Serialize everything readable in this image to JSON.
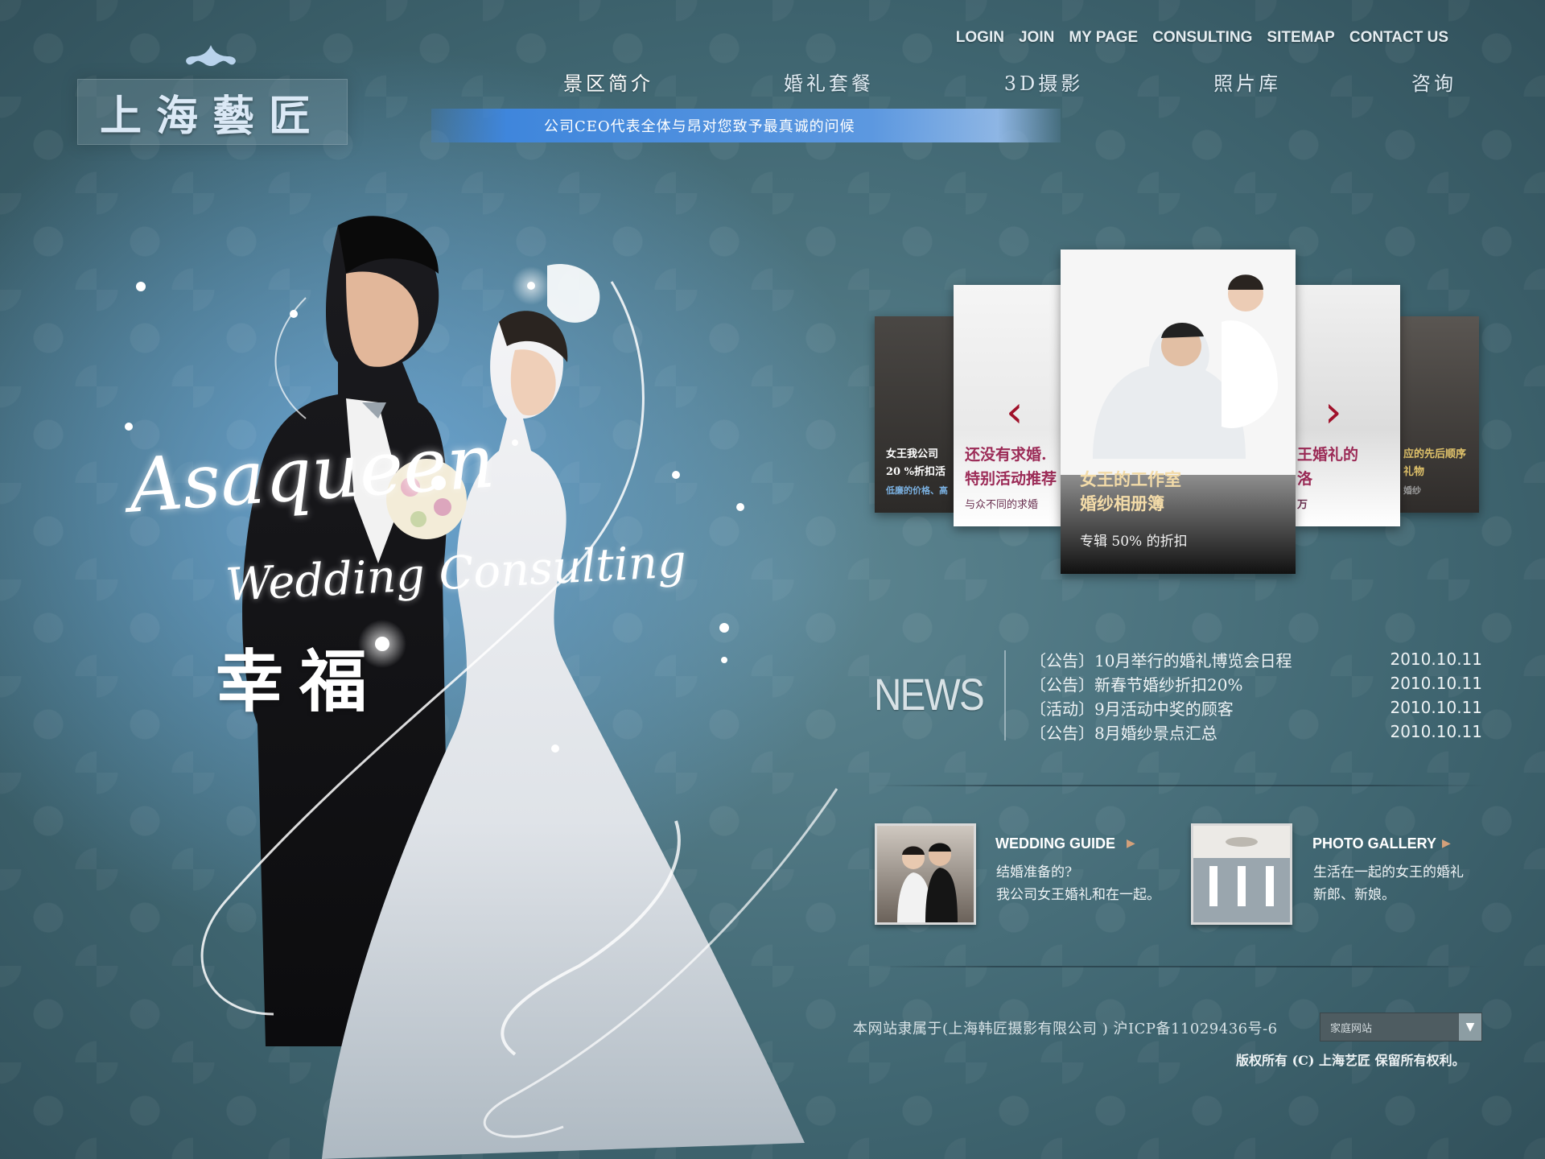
{
  "logo": {
    "text": "上海藝匠"
  },
  "top_links": [
    "LOGIN",
    "JOIN",
    "MY PAGE",
    "CONSULTING",
    "SITEMAP",
    "CONTACT US"
  ],
  "nav": [
    "景区简介",
    "婚礼套餐",
    "3D摄影",
    "照片库",
    "咨询"
  ],
  "banner_text": "公司CEO代表全体与昂对您致予最真诚的问候",
  "hero": {
    "script_line1": "Asaqueen",
    "script_line2": "Wedding Consulting",
    "happiness": "幸福"
  },
  "carousel": {
    "far_left": {
      "line1": "女王我公司",
      "line2": "20 %折扣活",
      "line3": "低廉的价格、高"
    },
    "near_left": {
      "line1": "还没有求婚.",
      "line2": "特别活动推荐",
      "line3": "与众不同的求婚"
    },
    "center": {
      "line1": "女王的工作室",
      "line2": "婚纱相册簿",
      "line3": "专辑 50% 的折扣"
    },
    "near_right": {
      "line1": "王婚礼的",
      "line2": "洛",
      "line3": "万"
    },
    "far_right": {
      "line1": "应的先后顺序",
      "line2": "礼物",
      "line3": "婚纱"
    },
    "prev_icon": "chevron-left-icon",
    "next_icon": "chevron-right-icon"
  },
  "news": {
    "label": "NEWS",
    "items": [
      {
        "title": "〔公告〕10月举行的婚礼博览会日程",
        "date": "2010.10.11"
      },
      {
        "title": "〔公告〕新春节婚纱折扣20%",
        "date": "2010.10.11"
      },
      {
        "title": "〔活动〕9月活动中奖的顾客",
        "date": "2010.10.11"
      },
      {
        "title": "〔公告〕8月婚纱景点汇总",
        "date": "2010.10.11"
      }
    ]
  },
  "features": [
    {
      "title": "WEDDING GUIDE",
      "line1": "结婚准备的?",
      "line2": "我公司女王婚礼和在一起。"
    },
    {
      "title": "PHOTO GALLERY",
      "line1": "生活在一起的女王的婚礼",
      "line2": "新郎、新娘。"
    }
  ],
  "footer": {
    "company": "本网站隶属于(上海韩匠摄影有限公司 ) 沪ICP备11029436号-6",
    "family_site": "家庭网站",
    "copyright": "版权所有 (C) 上海艺匠 保留所有权利。"
  },
  "colors": {
    "banner": "#3f86dc",
    "arrow": "#a0112a",
    "accent_arrow": "#d3a07a"
  }
}
